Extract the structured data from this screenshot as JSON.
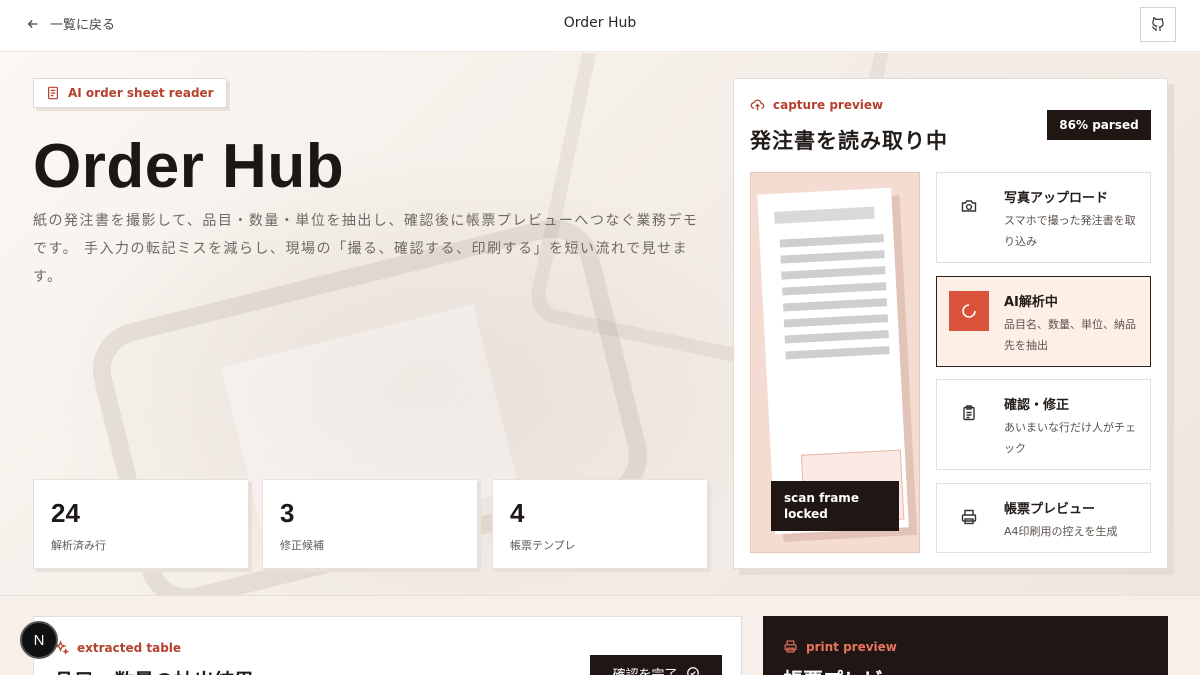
{
  "topbar": {
    "back_label": "一覧に戻る",
    "app_title": "Order Hub",
    "repo_icon": "github-icon"
  },
  "hero": {
    "pill_label": "AI order sheet reader",
    "title": "Order Hub",
    "description": "紙の発注書を撮影して、品目・数量・単位を抽出し、確認後に帳票プレビューへつなぐ業務デモです。 手入力の転記ミスを減らし、現場の「撮る、確認する、印刷する」を短い流れで見せます。",
    "stats": [
      {
        "value": "24",
        "label": "解析済み行"
      },
      {
        "value": "3",
        "label": "修正候補"
      },
      {
        "value": "4",
        "label": "帳票テンプレ"
      }
    ]
  },
  "capture": {
    "eyebrow": "capture preview",
    "title": "発注書を読み取り中",
    "badge": "86% parsed",
    "progress": 0.86,
    "scan_label": "scan frame locked",
    "steps": [
      {
        "title": "写真アップロード",
        "desc": "スマホで撮った発注書を取り込み",
        "icon": "camera-icon",
        "active": false
      },
      {
        "title": "AI解析中",
        "desc": "品目名、数量、単位、納品先を抽出",
        "icon": "spinner-icon",
        "active": true
      },
      {
        "title": "確認・修正",
        "desc": "あいまいな行だけ人がチェック",
        "icon": "clipboard-icon",
        "active": false
      },
      {
        "title": "帳票プレビュー",
        "desc": "A4印刷用の控えを生成",
        "icon": "printer-icon",
        "active": false
      }
    ]
  },
  "lower": {
    "table_eyebrow": "extracted table",
    "table_title": "品目・数量の抽出結果",
    "confirm_label": "確認を完了",
    "print_eyebrow": "print preview",
    "print_title": "帳票プレビュー"
  },
  "dev_badge": "N",
  "colors": {
    "accent": "#b5412e",
    "dark": "#201715",
    "active_bg": "#fdeee6",
    "spinner_bg": "#d9533c"
  }
}
